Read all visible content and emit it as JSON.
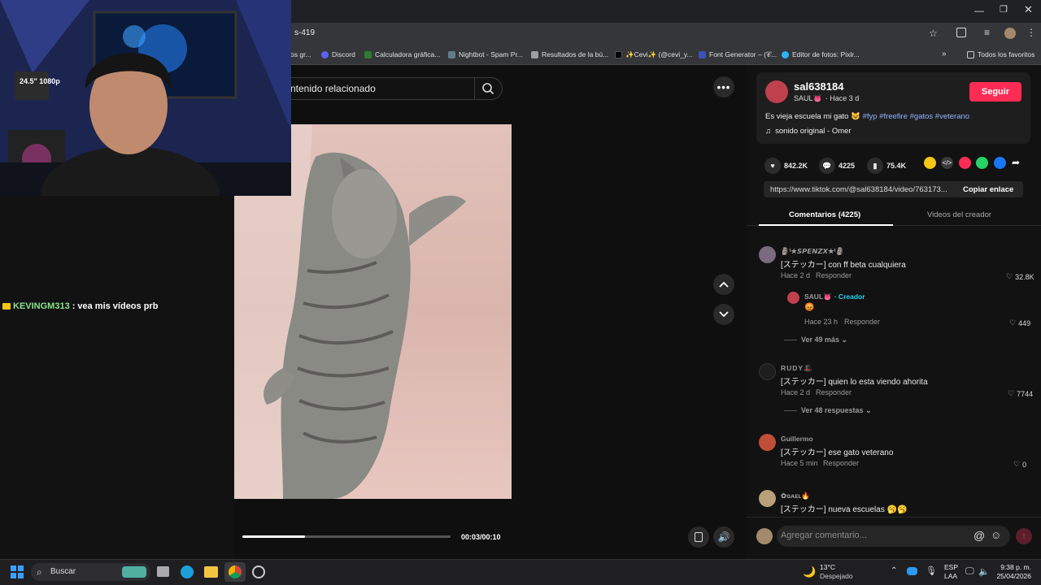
{
  "browser": {
    "url": "s-419",
    "bookmarks": [
      {
        "label": "os gr...",
        "color": "#888888"
      },
      {
        "label": "Discord",
        "color": "#5865f2"
      },
      {
        "label": "Calculadora gráfica...",
        "color": "#2e7d32"
      },
      {
        "label": "Nightbot - Spam Pr...",
        "color": "#607d8b"
      },
      {
        "label": "Resultados de la bú...",
        "color": "#9e9e9e"
      },
      {
        "label": "✨Cevi✨ (@cevi_y...",
        "color": "#000000"
      },
      {
        "label": "Font Generator – (𝒞...",
        "color": "#3f51b5"
      },
      {
        "label": "Editor de fotos: Pixlr...",
        "color": "#29b6f6"
      }
    ],
    "all_bookmarks": "Todos los favoritos"
  },
  "stream": {
    "chat_user": "KEVINGM313",
    "chat_sep": ":",
    "chat_message": "vea mis vídeos prb",
    "monitor_label": "24.5\" 1080p"
  },
  "video": {
    "search_placeholder": "ntenido relacionado",
    "time": "00:03/00:10",
    "progress": 0.3
  },
  "post": {
    "username": "sal638184",
    "display_name": "SAUL👅",
    "time_ago": "· Hace 3 d",
    "follow": "Seguir",
    "caption": "Es vieja escuela mi gato 😺",
    "hashtags": "#fyp #freefire #gatos #veterano",
    "sound": "sonido original - Omer",
    "likes": "842.2K",
    "comments": "4225",
    "saves": "75.4K",
    "link": "https://www.tiktok.com/@sal638184/video/763173...",
    "copy_link": "Copiar enlace"
  },
  "tabs": {
    "comments": "Comentarios (4225)",
    "creator_videos": "Videos del creador"
  },
  "comments": [
    {
      "user": "🗿ᵗ★𝙎𝙋𝙀𝙉𝙕𝙓★ᵗ🗿",
      "text": "[ステッカー] con ff beta cualquiera",
      "time": "Hace 2 d",
      "reply": "Responder",
      "likes": "32.8K",
      "avatar": "#7a6b80"
    },
    {
      "user": "RUDY🎩",
      "text": "[ステッカー] quien lo esta viendo ahorita",
      "time": "Hace 2 d",
      "reply": "Responder",
      "likes": "7744",
      "avatar": "#222222"
    },
    {
      "user": "Guillermo",
      "text": "[ステッカー] ese gato veterano",
      "time": "Hace 5 min",
      "reply": "Responder",
      "likes": "0",
      "avatar": "#c04f3a"
    },
    {
      "user": "✿ɢᴀᴇʟ🔥",
      "text": "[ステッカー] nueva escuelas 🥱🥱",
      "avatar": "#b7a07a"
    }
  ],
  "reply": {
    "user": "SAUL👅",
    "badge": "· Creador",
    "text": "😡",
    "time": "Hace 23 h",
    "reply": "Responder",
    "likes": "449"
  },
  "more_replies": [
    "Ver 49 más",
    "Ver 48 respuestas"
  ],
  "comment_placeholder": "Agregar comentario...",
  "taskbar": {
    "search": "Buscar",
    "weather_temp": "13°C",
    "weather_desc": "Despejado",
    "lang1": "ESP",
    "lang2": "LAA",
    "time": "9:38 p. m.",
    "date": "25/04/2026"
  },
  "colors": {
    "accent": "#fe2c55",
    "hashtag": "#8fb3ff",
    "creator": "#20d5ec"
  }
}
